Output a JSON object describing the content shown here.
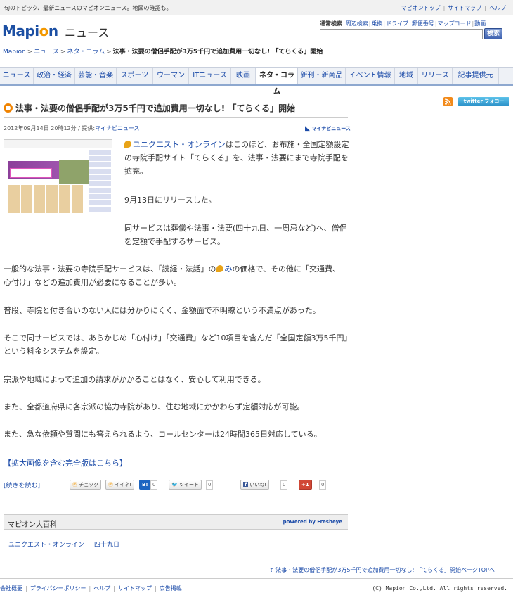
{
  "topbar": {
    "tagline": "旬のトピック、最新ニュースのマピオンニュース。地図の確認も。",
    "links": [
      "マピオントップ",
      "サイトマップ",
      "ヘルプ"
    ]
  },
  "header": {
    "logo_text_a": "Mapi",
    "logo_text_o": "o",
    "logo_text_b": "n",
    "section": "ニュース"
  },
  "search": {
    "tabs": [
      "通常検索",
      "周辺検索",
      "乗換",
      "ドライブ",
      "郵便番号",
      "マップコード",
      "動画"
    ],
    "placeholder": "",
    "button": "検索"
  },
  "breadcrumb": {
    "items": [
      "Mapion",
      "ニュース",
      "ネタ・コラム"
    ],
    "current": "法事・法要の僧侶手配が3万5千円で追加費用一切なし! 「てらくる」開始"
  },
  "nav": [
    "ニュース",
    "政治・経済",
    "芸能・音楽",
    "スポーツ",
    "ウーマン",
    "ITニュース",
    "映画",
    "ネタ・コラム",
    "新刊・新商品",
    "イベント情報",
    "地域",
    "リリース",
    "記事提供元"
  ],
  "nav_active": "ネタ・コラム",
  "article": {
    "title": "法事・法要の僧侶手配が3万5千円で追加費用一切なし! 「てらくる」開始",
    "date": "2012年09月14日 20時12分",
    "provider_prefix": "提供:",
    "provider": "マイナビニュース",
    "provider_logo": "マイナビニュース",
    "p1_link": "ユニクエスト・オンライン",
    "p1_rest": "はこのほど、お布施・全国定額設定の寺院手配サイト「てらくる」を、法事・法要にまで寺院手配を拡充。",
    "p2": "9月13日にリリースした。",
    "p3": "同サービスは葬儀や法事・法要(四十九日、一周忌など)へ、僧侶を定額で手配するサービス。",
    "p4_a": "一般的な法事・法要の寺院手配サービスは、「読経・法話」の",
    "p4_link": "み",
    "p4_b": "の価格で、その他に「交通費、心付け」などの追加費用が必要になることが多い。",
    "p5": "普段、寺院と付き合いのない人には分かりにくく、金額面で不明瞭という不満点があった。",
    "p6": "そこで同サービスでは、あらかじめ「心付け」「交通費」など10項目を含んだ「全国定額3万5千円」という料金システムを設定。",
    "p7": "宗派や地域によって追加の請求がかかることはなく、安心して利用できる。",
    "p8": "また、全都道府県に各宗派の協力寺院があり、住む地域にかかわらず定額対応が可能。",
    "p9": "また、急な依頼や質問にも答えられるよう、コールセンターは24時間365日対応している。",
    "full_link": "【拡大画像を含む完全版はこちら】",
    "readmore": "[続きを読む]"
  },
  "social": {
    "check": "チェック",
    "iine": "イイネ!",
    "hatena": "B!",
    "hatena_count": "0",
    "tweet": "ツイート",
    "tweet_count": "0",
    "fb": "いいね!",
    "fb_count": "0",
    "gplus": "+1",
    "gplus_count": "0",
    "twitter_follow": "twitter フォロー",
    "rss": "RSS"
  },
  "encyclopedia": {
    "title": "マピオン大百科",
    "powered": "powered by Fresheye",
    "tags": [
      "ユニクエスト・オンライン",
      "四十九日"
    ]
  },
  "pagetop": "法事・法要の僧侶手配が3万5千円で追加費用一切なし! 「てらくる」開始ページTOPへ",
  "footer": {
    "links": [
      "会社概要",
      "プライバシーポリシー",
      "ヘルプ",
      "サイトマップ",
      "広告掲載"
    ],
    "copyright": "(C) Mapion Co.,Ltd. All rights reserved."
  }
}
